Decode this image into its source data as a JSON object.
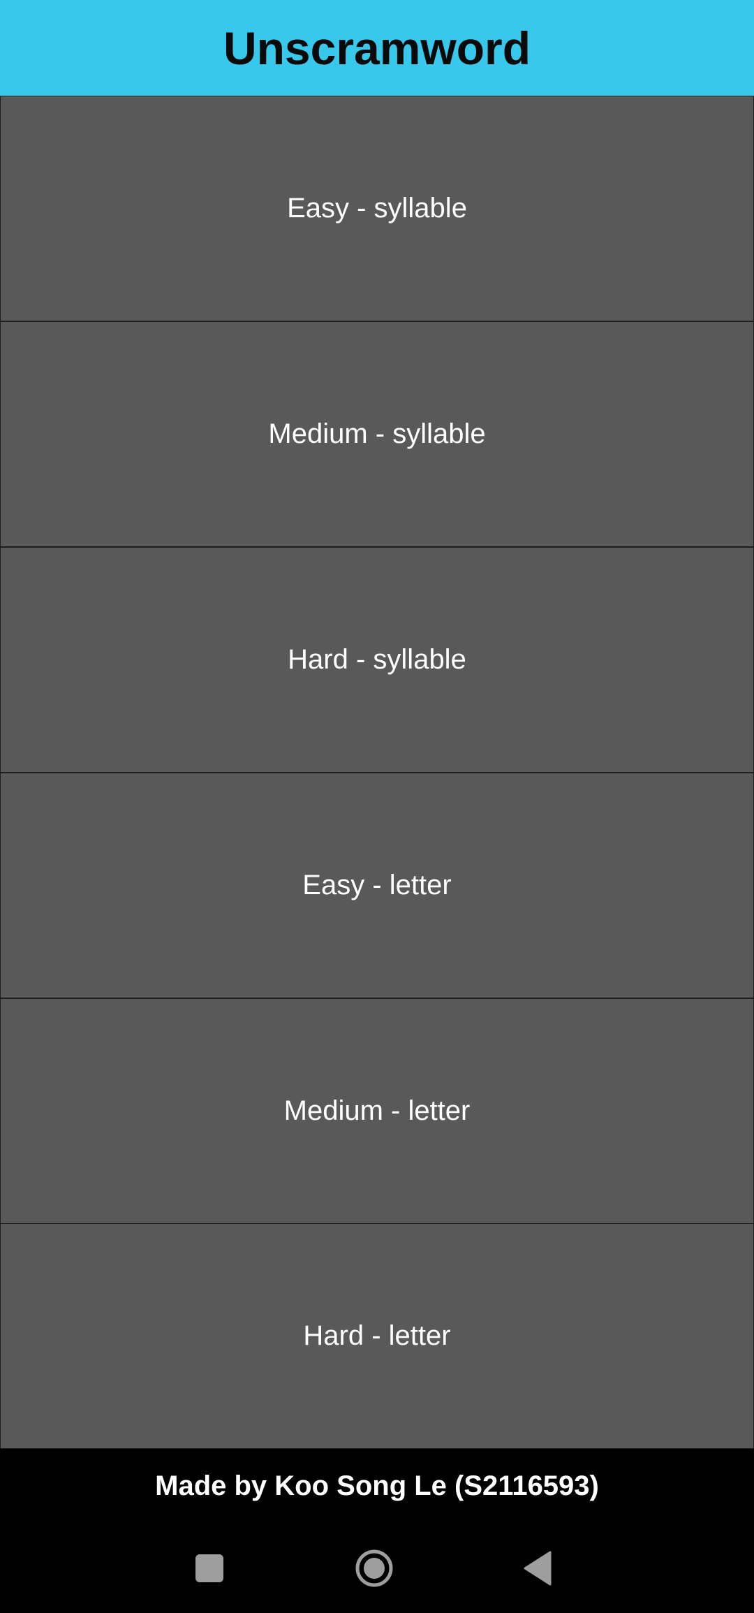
{
  "app": {
    "title": "Unscramword"
  },
  "menu": {
    "items": [
      {
        "label": "Easy - syllable"
      },
      {
        "label": "Medium - syllable"
      },
      {
        "label": "Hard - syllable"
      },
      {
        "label": "Easy - letter"
      },
      {
        "label": "Medium - letter"
      },
      {
        "label": "Hard - letter"
      }
    ]
  },
  "footer": {
    "credit": "Made by Koo Song Le (S2116593)"
  },
  "navbar": {
    "buttons": [
      {
        "icon": "recents-square-icon"
      },
      {
        "icon": "home-circle-icon"
      },
      {
        "icon": "back-triangle-icon"
      }
    ]
  },
  "colors": {
    "header_bg": "#37C8EB",
    "button_bg": "#595959",
    "button_border": "#1E1E1E",
    "background": "#000000",
    "text_light": "#FFFFFF",
    "nav_icon": "#9E9E9E"
  }
}
